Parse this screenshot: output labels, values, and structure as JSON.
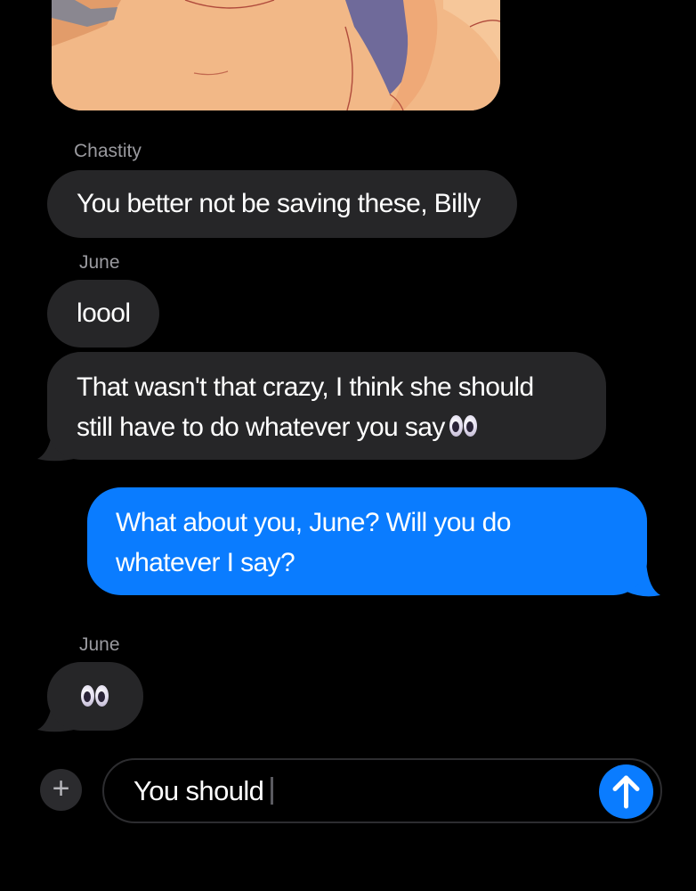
{
  "conversation": {
    "messages": [
      {
        "sender": "Chastity",
        "lines": [
          "You better not be saving these, Billy"
        ]
      },
      {
        "sender": "June",
        "lines": [
          "loool"
        ]
      },
      {
        "sender": "June",
        "lines": [
          "That wasn't that crazy, I think she should",
          "still have to do whatever you say"
        ],
        "trailing_emoji": "eyes-emoji"
      },
      {
        "sender": "me",
        "lines": [
          "What about you, June? Will you do",
          "whatever I say?"
        ]
      },
      {
        "sender": "June",
        "lines": [],
        "trailing_emoji": "eyes-emoji"
      }
    ]
  },
  "composer": {
    "draft_text": "You should",
    "plus_label": "+",
    "send_icon": "arrow-up-icon"
  },
  "colors": {
    "background": "#000000",
    "incoming_bubble": "#262628",
    "outgoing_bubble": "#0a7cff",
    "sender_label": "#9a9a9f",
    "accent": "#0a7cff"
  }
}
